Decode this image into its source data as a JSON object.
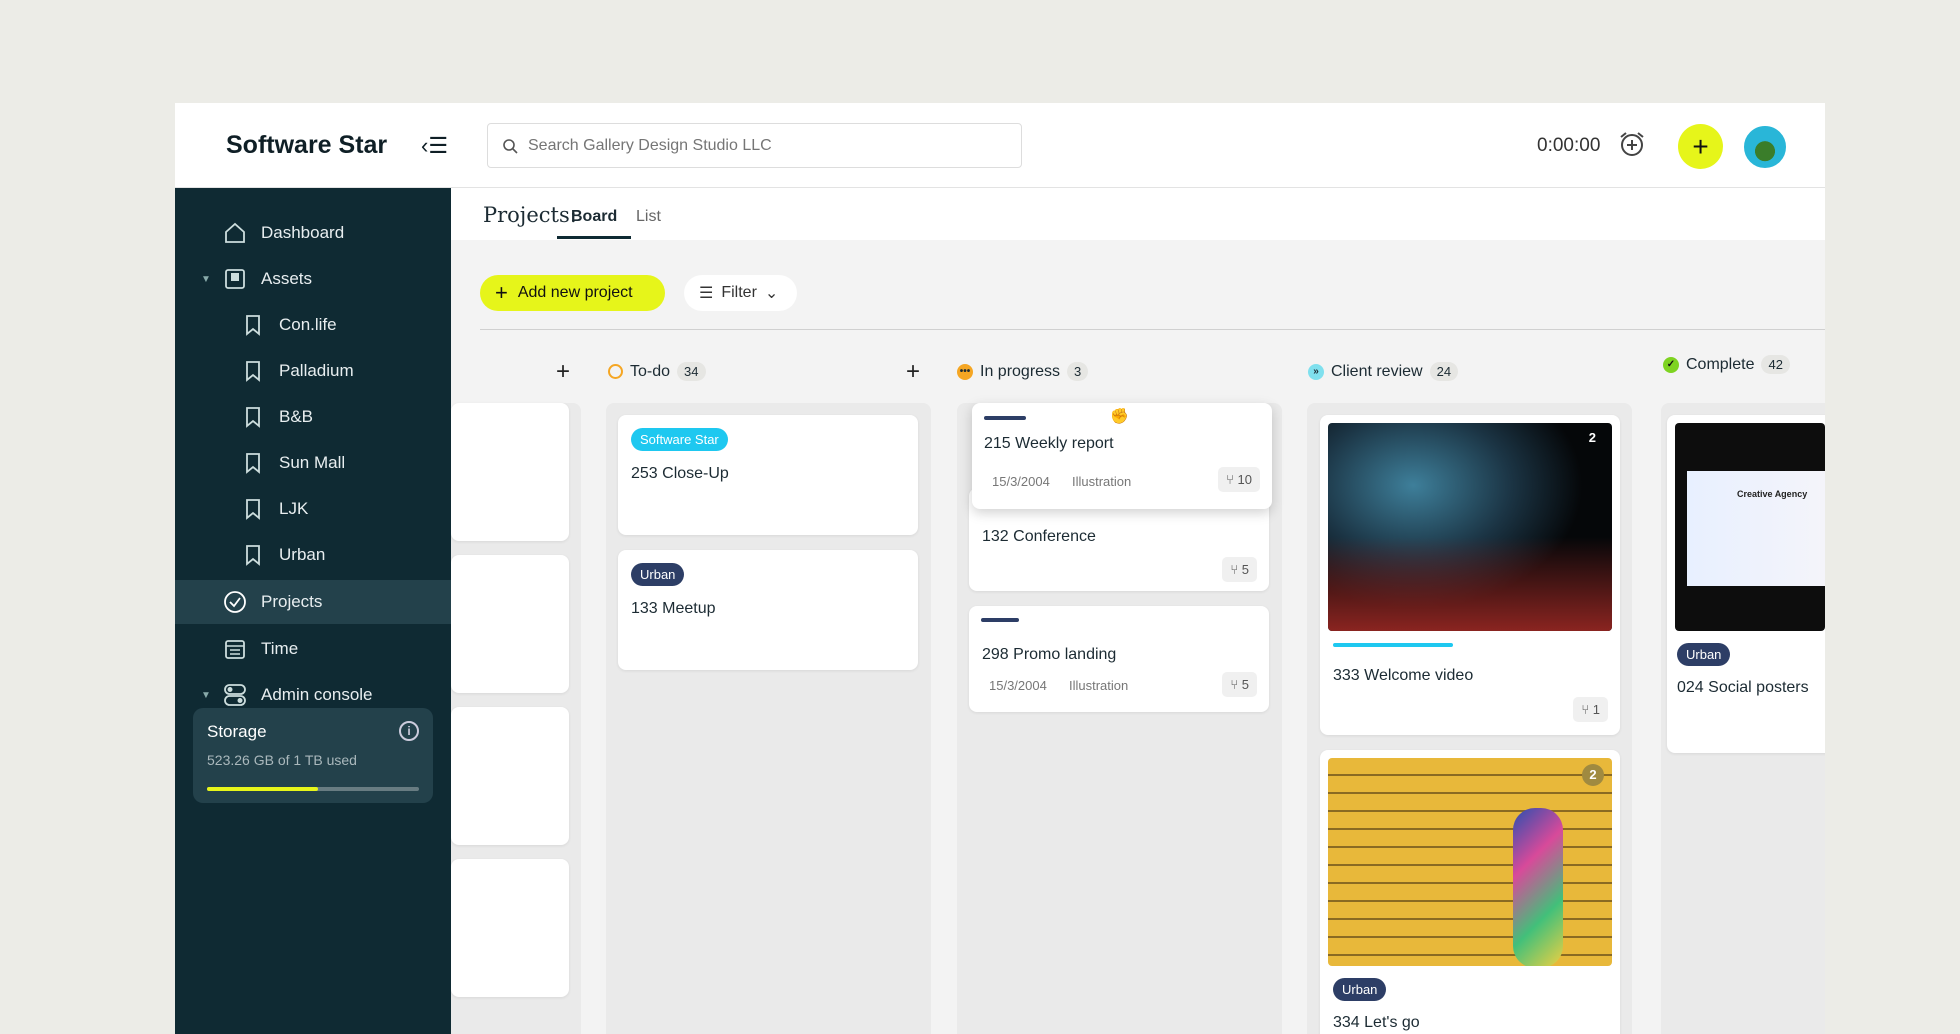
{
  "header": {
    "brand": "Software Star",
    "search_placeholder": "Search Gallery Design Studio LLC",
    "timer": "0:00:00"
  },
  "sidebar": {
    "items": [
      {
        "label": "Dashboard"
      },
      {
        "label": "Assets"
      },
      {
        "label": "Con.life"
      },
      {
        "label": "Palladium"
      },
      {
        "label": "B&B"
      },
      {
        "label": "Sun Mall"
      },
      {
        "label": "LJK"
      },
      {
        "label": "Urban"
      },
      {
        "label": "Projects"
      },
      {
        "label": "Time"
      },
      {
        "label": "Admin console"
      }
    ],
    "storage": {
      "title": "Storage",
      "usage": "523.26 GB of 1 TB used",
      "fraction": 0.523
    }
  },
  "main": {
    "title": "Projects:",
    "tabs": [
      {
        "label": "Board"
      },
      {
        "label": "List"
      }
    ],
    "add_label": "Add new project",
    "filter_label": "Filter",
    "columns": [
      {
        "name": "To-do",
        "count": "34",
        "color": "#f5a623",
        "cards": [
          {
            "tag": "Software Star",
            "tag_color": "#1ec8f0",
            "title": "253 Close-Up"
          },
          {
            "tag": "Urban",
            "tag_color": "#2d3e66",
            "title": "133 Meetup"
          }
        ]
      },
      {
        "name": "In progress",
        "count": "3",
        "color": "#f5a623",
        "cards": [
          {
            "title": "215 Weekly report",
            "date": "15/3/2004",
            "category": "Illustration",
            "subtasks": "10"
          },
          {
            "title": "132 Conference",
            "subtasks": "5"
          },
          {
            "title": "298 Promo landing",
            "date": "15/3/2004",
            "category": "Illustration",
            "subtasks": "5"
          }
        ]
      },
      {
        "name": "Client review",
        "count": "24",
        "color": "#7fe0ee",
        "cards": [
          {
            "title": "333 Welcome video",
            "subtasks": "1",
            "image_count": "2",
            "progress": 0.45
          },
          {
            "title": "334 Let's go",
            "tag": "Urban",
            "image_count": "2"
          }
        ]
      },
      {
        "name": "Complete",
        "count": "42",
        "color": "#7ed321",
        "cards": [
          {
            "title": "024 Social posters",
            "tag": "Urban",
            "image_text": "Creative Agency"
          }
        ]
      }
    ]
  }
}
